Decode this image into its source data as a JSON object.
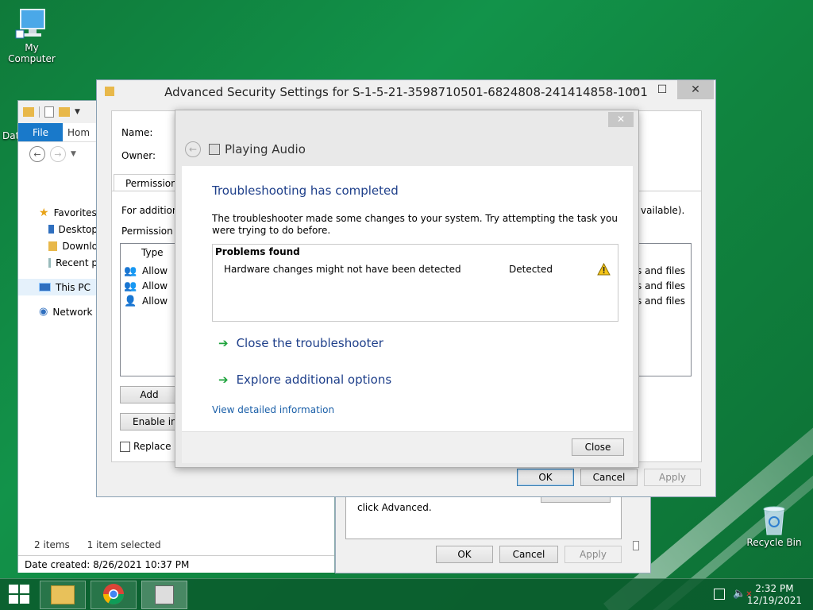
{
  "desktop": {
    "icons": [
      {
        "label": "My Computer"
      },
      {
        "label": "Recycle Bin"
      }
    ],
    "partial_labels": [
      "Dat"
    ]
  },
  "explorer": {
    "ribbon_tabs": [
      "File",
      "Hom"
    ],
    "nav_items": [
      {
        "label": "Favorites"
      },
      {
        "label": "Desktop"
      },
      {
        "label": "Downlo"
      },
      {
        "label": "Recent p"
      },
      {
        "label": "This PC"
      },
      {
        "label": "Network"
      }
    ],
    "status_items": "2 items",
    "status_selected": "1 item selected",
    "date_created": "Date created: 8/26/2021 10:37 PM"
  },
  "properties": {
    "text": "click Advanced.",
    "buttons": {
      "ok": "OK",
      "cancel": "Cancel",
      "apply": "Apply"
    }
  },
  "advanced": {
    "title": "Advanced Security Settings for S-1-5-21-3598710501-6824808-241414858-1001",
    "name_label": "Name:",
    "owner_label": "Owner:",
    "tab_label": "Permissions",
    "for_additional": "For additiona",
    "permission_entries": "Permission e",
    "available_suffix": "vailable).",
    "column_type": "Type",
    "rows": [
      {
        "type": "Allow",
        "applies": "s and files"
      },
      {
        "type": "Allow",
        "applies": "s and files"
      },
      {
        "type": "Allow",
        "applies": "s and files"
      }
    ],
    "add_button": "Add",
    "enable_inherit_button": "Enable inh",
    "replace_checkbox": "Replace al",
    "buttons": {
      "ok": "OK",
      "cancel": "Cancel",
      "apply": "Apply"
    }
  },
  "troubleshooter": {
    "header": "Playing Audio",
    "heading": "Troubleshooting has completed",
    "description": "The troubleshooter made some changes to your system. Try attempting the task you were trying to do before.",
    "problems_header": "Problems found",
    "problem": {
      "text": "Hardware changes might not have been detected",
      "status": "Detected"
    },
    "actions": [
      {
        "label": "Close the troubleshooter"
      },
      {
        "label": "Explore additional options"
      }
    ],
    "details_link": "View detailed information",
    "close_button": "Close"
  },
  "taskbar": {
    "time": "2:32 PM",
    "date": "12/19/2021"
  }
}
